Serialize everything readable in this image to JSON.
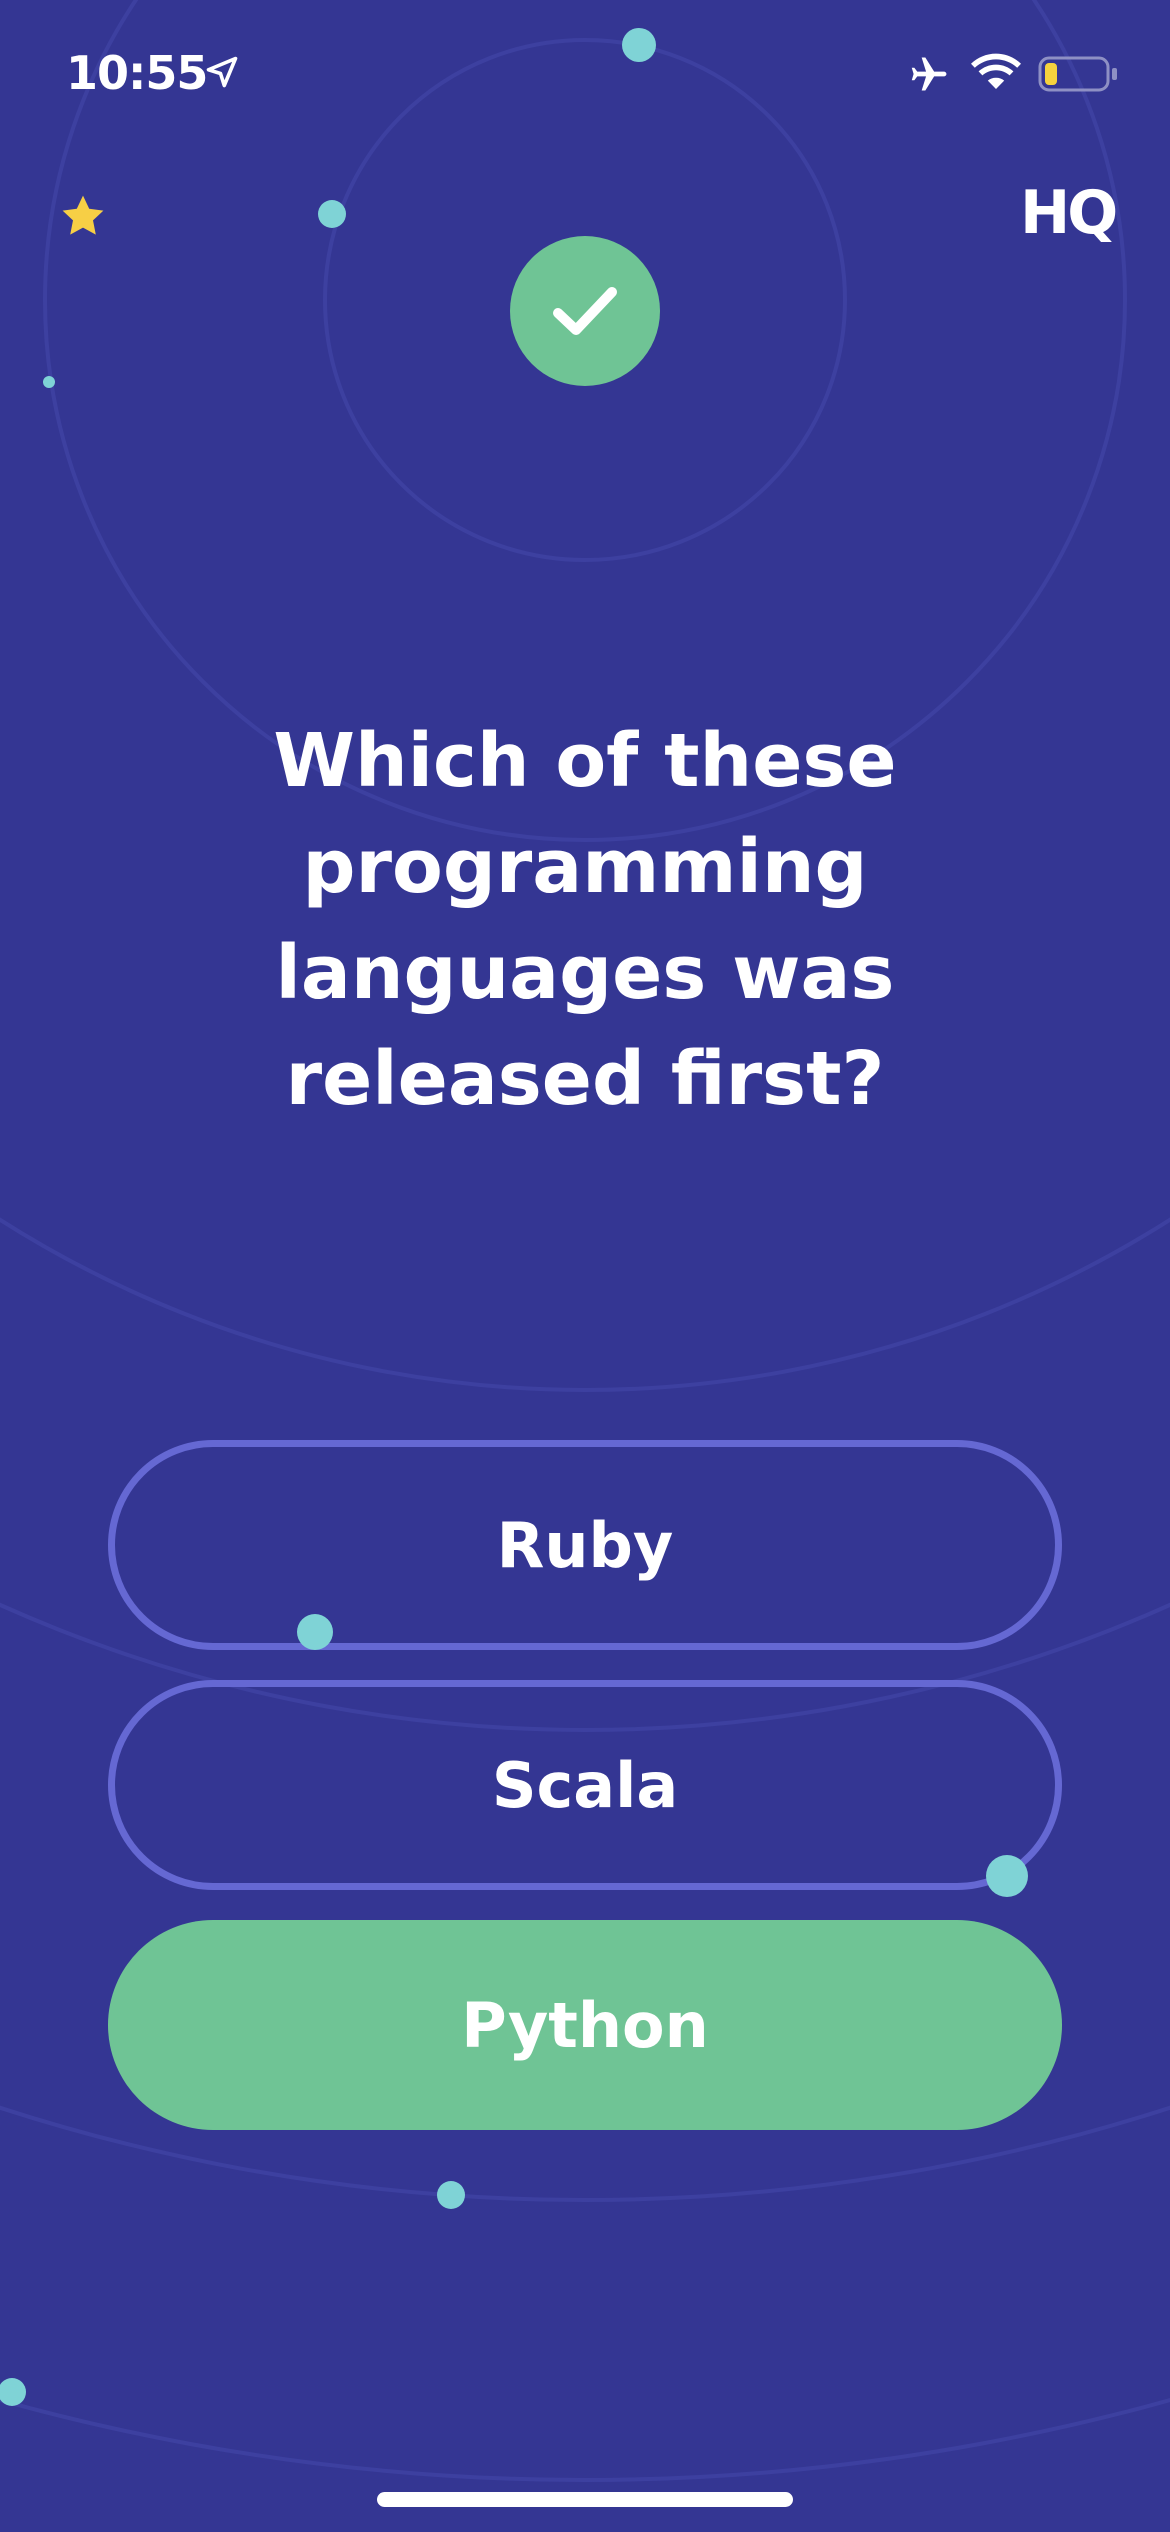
{
  "status_bar": {
    "time": "10:55",
    "icons": [
      "location-arrow-icon",
      "airplane-icon",
      "wifi-icon",
      "battery-icon"
    ],
    "battery_color": "#f5d23e"
  },
  "header": {
    "logo": "HQ",
    "star_color": "#f7cf45",
    "result_icon": "checkmark-icon"
  },
  "question": {
    "text": "Which of these programming languages was released first?"
  },
  "answers": [
    {
      "label": "Ruby",
      "state": "default"
    },
    {
      "label": "Scala",
      "state": "default"
    },
    {
      "label": "Python",
      "state": "correct"
    }
  ],
  "colors": {
    "background": "#343693",
    "correct": "#6fc495",
    "outline": "#6568d3",
    "dot": "#7fd3d6"
  }
}
